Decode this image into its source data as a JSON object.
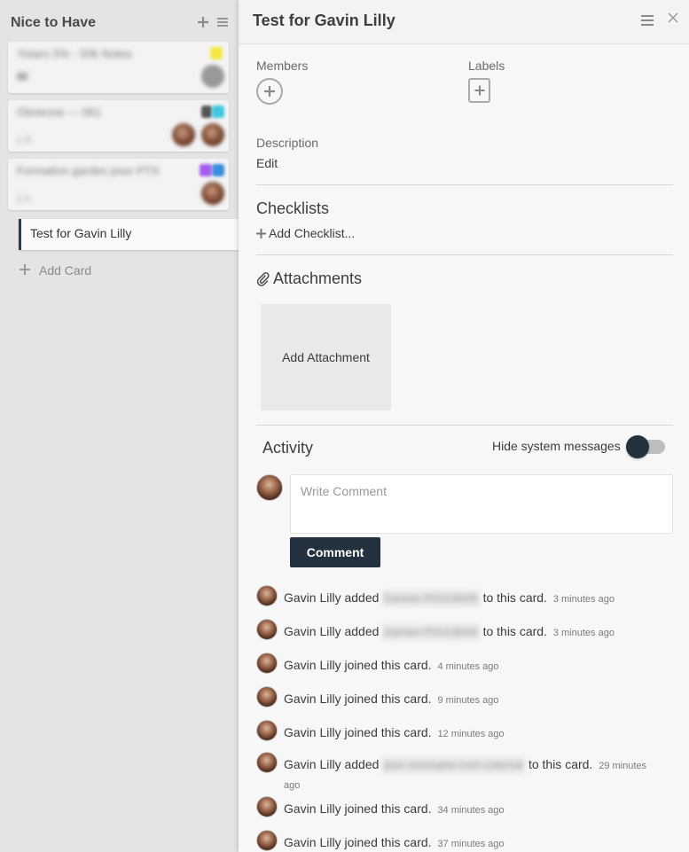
{
  "list": {
    "title": "Nice to Have",
    "cards": [
      {
        "title": "Yotaro 5% - 50k Notes",
        "sub": "▮▮"
      },
      {
        "title": "Obrienne — 061",
        "sub": "▯ 3"
      },
      {
        "title": "Formation gardes pour PTS",
        "sub": "▯ 1"
      }
    ],
    "active_card": "Test for Gavin Lilly",
    "add_card": "Add Card"
  },
  "panel": {
    "title": "Test for Gavin Lilly",
    "members_label": "Members",
    "labels_label": "Labels",
    "description_label": "Description",
    "description_edit": "Edit",
    "checklists_title": "Checklists",
    "add_checklist": "Add Checklist...",
    "attachments_title": "Attachments",
    "add_attachment": "Add Attachment",
    "activity_title": "Activity",
    "hide_system_messages": "Hide system messages",
    "comment_placeholder": "Write Comment",
    "comment_button": "Comment"
  },
  "activity": [
    {
      "user": "Gavin Lilly",
      "action": "added",
      "blurred": "Damien POULBAIN",
      "suffix": "to this card.",
      "ago": "3 minutes ago"
    },
    {
      "user": "Gavin Lilly",
      "action": "added",
      "blurred": "Damien POULBAIN",
      "suffix": "to this card.",
      "ago": "3 minutes ago"
    },
    {
      "user": "Gavin Lilly",
      "action": "joined this card.",
      "ago": "4 minutes ago"
    },
    {
      "user": "Gavin Lilly",
      "action": "joined this card.",
      "ago": "9 minutes ago"
    },
    {
      "user": "Gavin Lilly",
      "action": "joined this card.",
      "ago": "12 minutes ago"
    },
    {
      "user": "Gavin Lilly",
      "action": "added",
      "blurred": "jean christophe roch cotterval",
      "suffix": "to this card.",
      "ago": "29 minutes ago"
    },
    {
      "user": "Gavin Lilly",
      "action": "joined this card.",
      "ago": "34 minutes ago"
    },
    {
      "user": "Gavin Lilly",
      "action": "joined this card.",
      "ago": "37 minutes ago"
    }
  ],
  "colors": {
    "accent_dark": "#23303d",
    "label_yellow": "#f5e642",
    "label_teal": "#3fc8e0",
    "label_purple": "#a95cf0",
    "label_blue": "#3a8ee0"
  }
}
